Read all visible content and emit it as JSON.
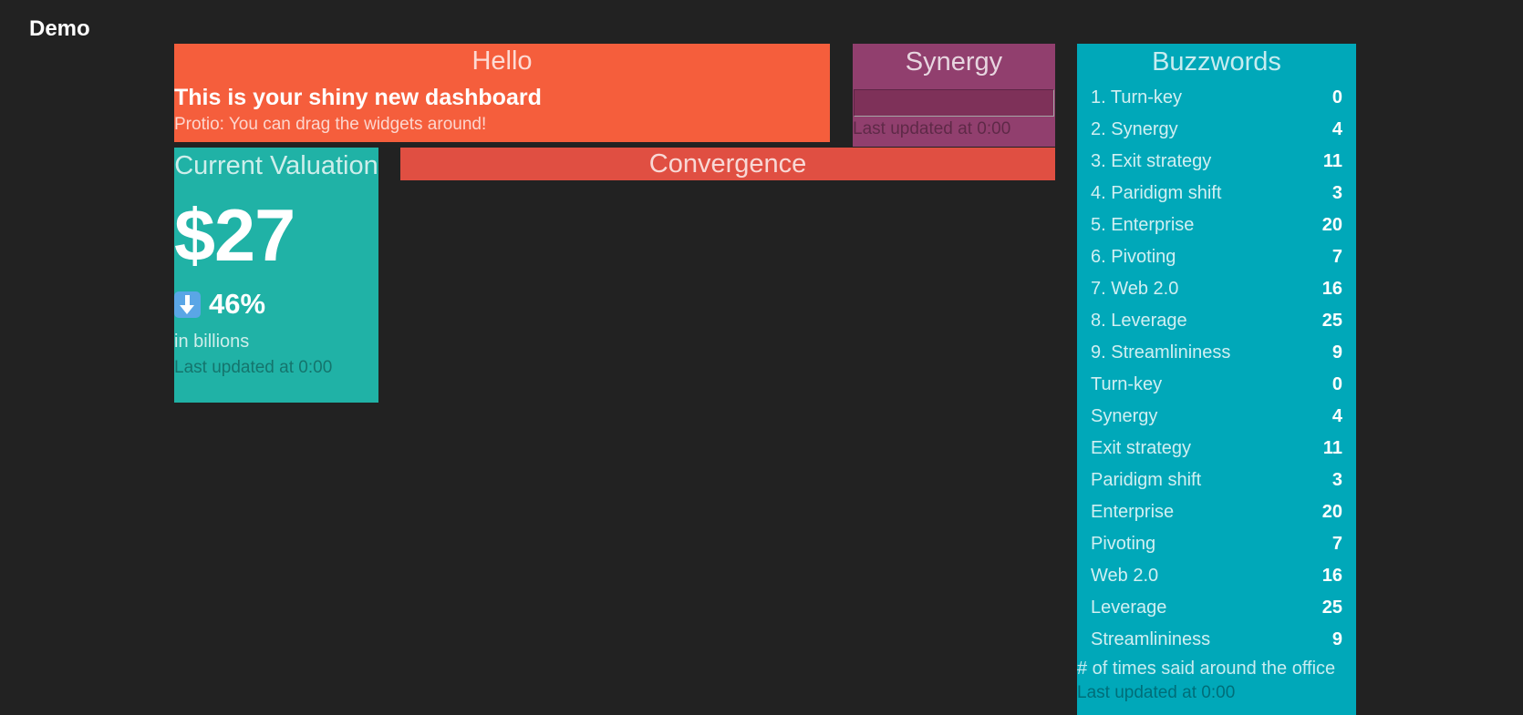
{
  "app": {
    "title": "Demo"
  },
  "hello": {
    "title": "Hello",
    "headline": "This is your shiny new dashboard",
    "tip": "Protio: You can drag the widgets around!"
  },
  "synergy": {
    "title": "Synergy",
    "updated": "Last updated at 0:00"
  },
  "valuation": {
    "title": "Current Valuation",
    "value": "$27",
    "change_icon": "down-arrow-icon",
    "change": "46%",
    "more": "in billions",
    "updated": "Last updated at 0:00"
  },
  "convergence": {
    "title": "Convergence"
  },
  "buzzwords": {
    "title": "Buzzwords",
    "items": [
      {
        "label": "1. Turn-key",
        "value": "0"
      },
      {
        "label": "2. Synergy",
        "value": "4"
      },
      {
        "label": "3. Exit strategy",
        "value": "11"
      },
      {
        "label": "4. Paridigm shift",
        "value": "3"
      },
      {
        "label": "5. Enterprise",
        "value": "20"
      },
      {
        "label": "6. Pivoting",
        "value": "7"
      },
      {
        "label": "7. Web 2.0",
        "value": "16"
      },
      {
        "label": "8. Leverage",
        "value": "25"
      },
      {
        "label": "9. Streamlininess",
        "value": "9"
      },
      {
        "label": "Turn-key",
        "value": "0"
      },
      {
        "label": "Synergy",
        "value": "4"
      },
      {
        "label": "Exit strategy",
        "value": "11"
      },
      {
        "label": "Paridigm shift",
        "value": "3"
      },
      {
        "label": "Enterprise",
        "value": "20"
      },
      {
        "label": "Pivoting",
        "value": "7"
      },
      {
        "label": "Web 2.0",
        "value": "16"
      },
      {
        "label": "Leverage",
        "value": "25"
      },
      {
        "label": "Streamlininess",
        "value": "9"
      }
    ],
    "more": "# of times said around the office",
    "updated": "Last updated at 0:00"
  },
  "colors": {
    "background": "#222222",
    "hello": "#f55e3c",
    "synergy": "#913f6e",
    "valuation": "#20b2a6",
    "convergence": "#e04f42",
    "buzzwords": "#00a8b9"
  }
}
